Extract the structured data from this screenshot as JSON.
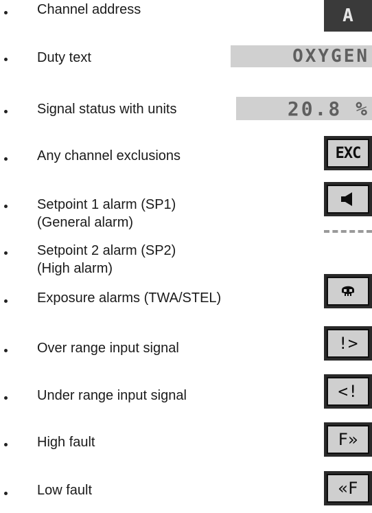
{
  "items": [
    {
      "label_lines": [
        "Channel address"
      ],
      "indicator": "channel-address-display",
      "text": "A"
    },
    {
      "label_lines": [
        "Duty text"
      ],
      "indicator": "duty-text-display",
      "text": "OXYGEN"
    },
    {
      "label_lines": [
        "Signal status with units"
      ],
      "indicator": "signal-status-display",
      "text": "20.8 %"
    },
    {
      "label_lines": [
        "Any channel exclusions"
      ],
      "indicator": "exc-icon",
      "text": "EXC"
    },
    {
      "label_lines": [
        "Setpoint 1 alarm (SP1)",
        "(General alarm)"
      ],
      "indicator": "horn-icon"
    },
    {
      "label_lines": [
        "Setpoint 2 alarm (SP2)",
        "(High alarm)"
      ],
      "indicator": "dashed-line"
    },
    {
      "label_lines": [
        "Exposure alarms (TWA/STEL)"
      ],
      "indicator": "skull-icon"
    },
    {
      "label_lines": [
        "Over range input signal"
      ],
      "indicator": "over-range-icon",
      "text": "!>"
    },
    {
      "label_lines": [
        "Under range input signal"
      ],
      "indicator": "under-range-icon",
      "text": "<!"
    },
    {
      "label_lines": [
        "High fault"
      ],
      "indicator": "high-fault-icon",
      "text": "F»"
    },
    {
      "label_lines": [
        "Low fault"
      ],
      "indicator": "low-fault-icon",
      "text": "«F"
    }
  ]
}
